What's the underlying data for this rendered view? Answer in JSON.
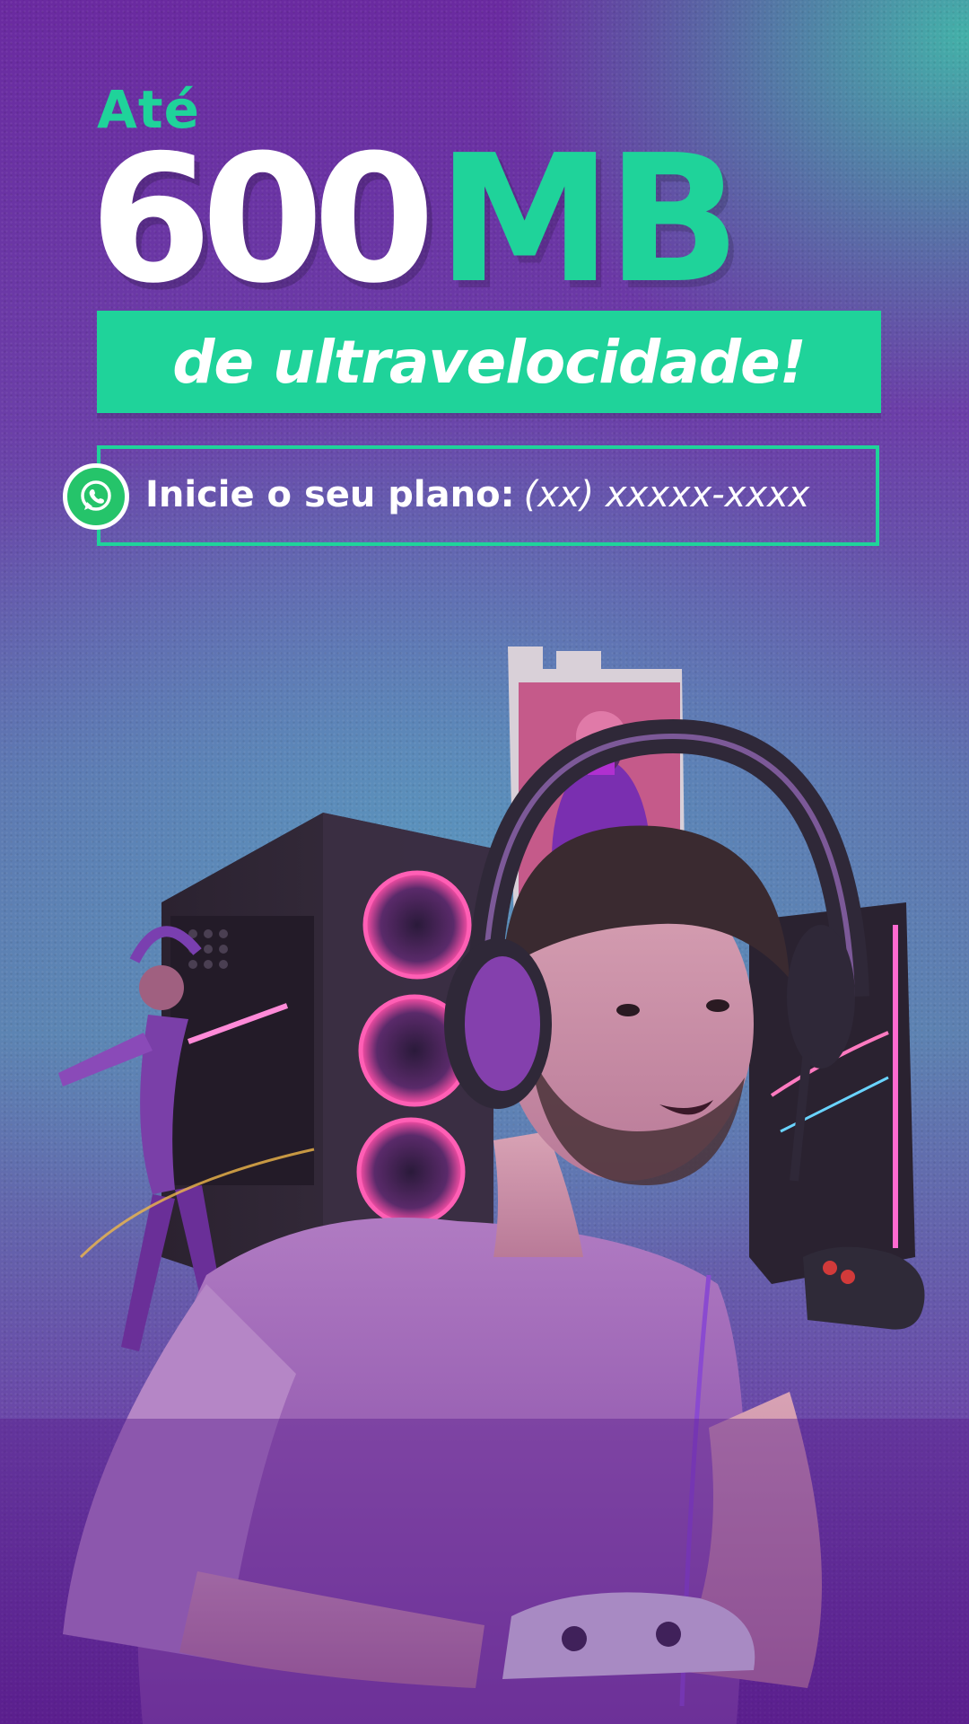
{
  "headline": {
    "prefix": "Até",
    "number": "600",
    "unit": "MB",
    "tagline": "de ultravelocidade!"
  },
  "cta": {
    "label": "Inicie o seu plano:",
    "phone": "(xx) xxxxx-xxxx",
    "icon": "whatsapp-icon"
  },
  "colors": {
    "accent": "#1fd39a",
    "background_top": "#6a2aa0",
    "background_mid": "#5d80b0",
    "background_bottom": "#5b1f8e",
    "text": "#ffffff"
  }
}
